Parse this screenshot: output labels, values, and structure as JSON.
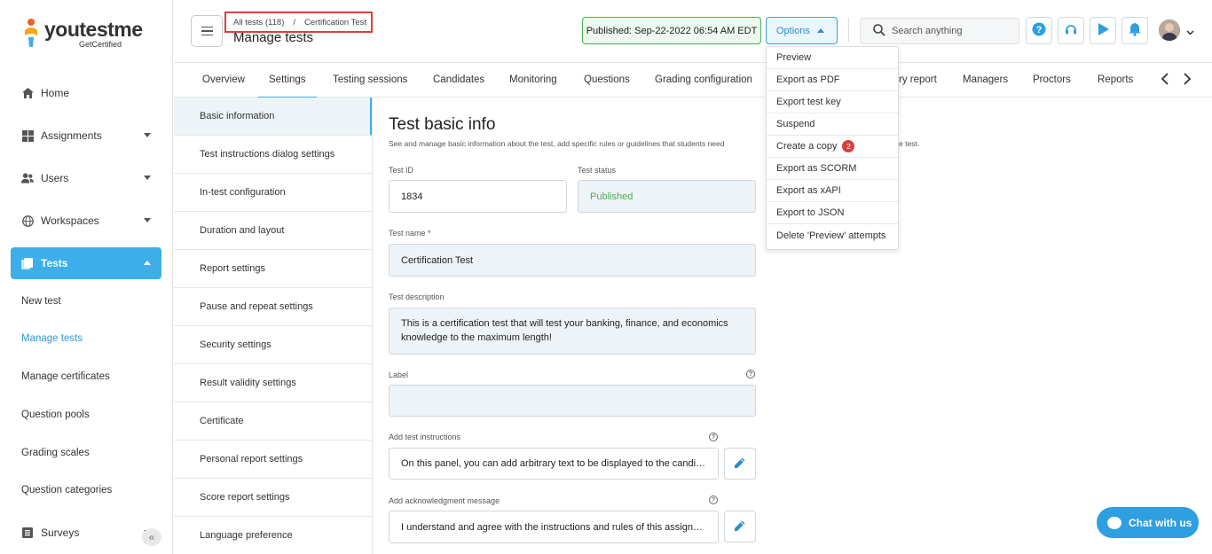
{
  "colors": {
    "accent": "#3daee9",
    "published_green": "#4caf50",
    "breadcrumb_highlight": "#d9413e",
    "badge_red": "#d9413e"
  },
  "logo": {
    "text": "youtestme",
    "sub": "GetCertified"
  },
  "sidebar": {
    "items": [
      {
        "label": "Home",
        "icon": "home-icon"
      },
      {
        "label": "Assignments",
        "icon": "assignments-icon"
      },
      {
        "label": "Users",
        "icon": "users-icon"
      },
      {
        "label": "Workspaces",
        "icon": "globe-icon"
      },
      {
        "label": "Tests",
        "icon": "tests-icon"
      }
    ],
    "sub_items": [
      {
        "label": "New test"
      },
      {
        "label": "Manage tests"
      },
      {
        "label": "Manage certificates"
      },
      {
        "label": "Question pools"
      },
      {
        "label": "Grading scales"
      },
      {
        "label": "Question categories"
      }
    ],
    "surveys": {
      "label": "Surveys"
    },
    "collapse_glyph": "«"
  },
  "header": {
    "breadcrumb": {
      "root": "All tests (118)",
      "separator": "/",
      "current": "Certification Test"
    },
    "title": "Manage tests",
    "published": "Published: Sep-22-2022 06:54 AM EDT",
    "options_label": "Options",
    "search_placeholder": "Search anything"
  },
  "tabs": [
    "Overview",
    "Settings",
    "Testing sessions",
    "Candidates",
    "Monitoring",
    "Questions",
    "Grading configuration",
    "ry report",
    "Managers",
    "Proctors",
    "Reports"
  ],
  "tab_nav": {
    "prev": "‹",
    "next": "›"
  },
  "settings_menu": [
    "Basic information",
    "Test instructions dialog settings",
    "In-test configuration",
    "Duration and layout",
    "Report settings",
    "Pause and repeat settings",
    "Security settings",
    "Result validity settings",
    "Certificate",
    "Personal report settings",
    "Score report settings",
    "Language preference"
  ],
  "form": {
    "title": "Test basic info",
    "description": "See and manage basic information about the test, add specific rules or guidelines that students need",
    "description_tail": "e test.",
    "test_id": {
      "label": "Test ID",
      "value": "1834"
    },
    "test_status": {
      "label": "Test status",
      "value": "Published"
    },
    "test_name": {
      "label": "Test name *",
      "value": "Certification Test"
    },
    "test_description": {
      "label": "Test description",
      "value": "This is a certification test that will test your banking, finance, and economics knowledge to the maximum length!"
    },
    "label_field": {
      "label": "Label",
      "value": ""
    },
    "instructions": {
      "label": "Add test instructions",
      "value": "On this panel, you can add arbitrary text to be displayed to the candidates before they start the test."
    },
    "acknowledgment": {
      "label": "Add acknowledgment message",
      "value": "I understand and agree with the instructions and rules of this assignment."
    },
    "help_glyph": "?"
  },
  "options_menu": [
    {
      "label": "Preview"
    },
    {
      "label": "Export as PDF"
    },
    {
      "label": "Export test key"
    },
    {
      "label": "Suspend"
    },
    {
      "label": "Create a copy",
      "badge": "2"
    },
    {
      "label": "Export as SCORM"
    },
    {
      "label": "Export as xAPI"
    },
    {
      "label": "Export to JSON"
    },
    {
      "label": "Delete 'Preview' attempts"
    }
  ],
  "chat": {
    "label": "Chat with us"
  }
}
